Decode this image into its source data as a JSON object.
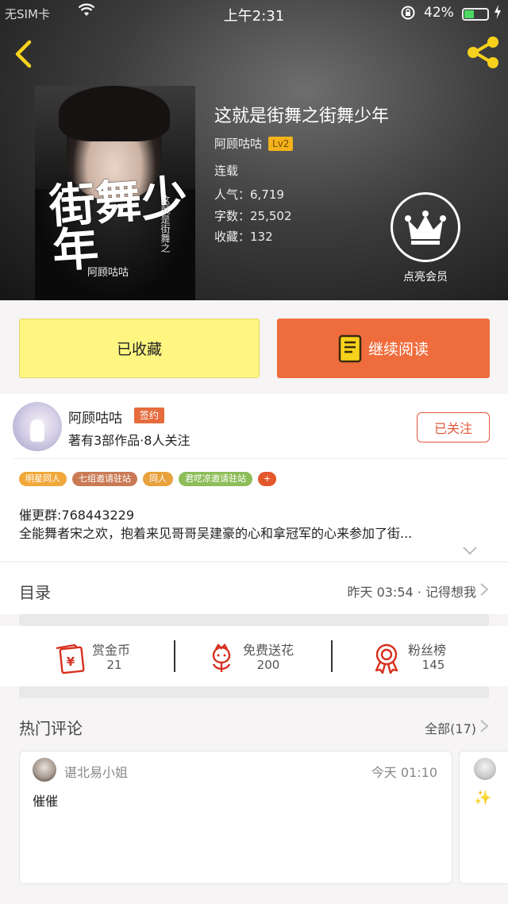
{
  "status_bar": {
    "carrier": "无SIM卡",
    "time": "上午2:31",
    "battery_percent": "42%",
    "battery_level": 0.42,
    "wifi_icon": "wifi-icon",
    "lock_icon": "rotation-lock-icon"
  },
  "book": {
    "title": "这就是街舞之街舞少年",
    "author": "阿顾咕咕",
    "level": "Lv2",
    "status": "连载",
    "popularity": "人气：6,719",
    "word_count": "字数：25,502",
    "collections": "收藏：132",
    "cover": {
      "title": "街舞少年",
      "subtitle": "这就是街舞之",
      "author": "阿顾咕咕"
    }
  },
  "vip": {
    "label": "点亮会员"
  },
  "actions": {
    "favorited_label": "已收藏",
    "continue_label": "继续阅读"
  },
  "author_card": {
    "name": "阿顾咕咕",
    "badge": "签约",
    "info": "著有3部作品·8人关注",
    "follow_label": "已关注"
  },
  "tags": [
    "明星同人",
    "七组邀请驻站",
    "同人",
    "君呓凉邀请驻站",
    "+"
  ],
  "description": {
    "line1": "催更群:768443229",
    "line2": "全能舞者宋之欢，抱着来见哥哥吴建豪的心和拿冠军的心来参加了街..."
  },
  "catalog": {
    "title": "目录",
    "update": "昨天 03:54 · 记得想我"
  },
  "stats": [
    {
      "label": "赏金币",
      "value": "21",
      "icon": "red-envelope-icon"
    },
    {
      "label": "免费送花",
      "value": "200",
      "icon": "flower-icon"
    },
    {
      "label": "粉丝榜",
      "value": "145",
      "icon": "medal-icon"
    }
  ],
  "comments": {
    "title": "热门评论",
    "all_label": "全部(17)",
    "items": [
      {
        "user": "谌北易小姐",
        "time": "今天 01:10",
        "text": "催催"
      }
    ]
  },
  "colors": {
    "accent_orange": "#ef6c3c",
    "fav_yellow": "#fef681",
    "icon_red": "#d7301f",
    "level_badge": "#f4b21b"
  }
}
